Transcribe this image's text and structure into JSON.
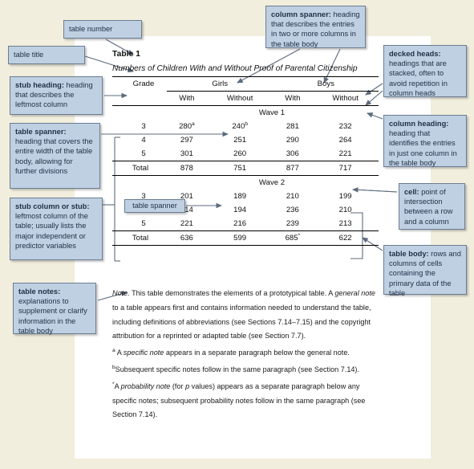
{
  "colors": {
    "page_background": "#f2eedd",
    "panel_background": "#ffffff",
    "callout_fill": "#bfd0e3",
    "callout_border": "#6a7d92",
    "callout_text": "#1f2f45",
    "rule_color": "#000000",
    "arrow_color": "#5c6b7d"
  },
  "table": {
    "number": "Table 1",
    "title": "Numbers of Children With and Without Proof of Parental Citizenship",
    "stub_heading": "Grade",
    "column_spanners": [
      "Girls",
      "Boys"
    ],
    "column_headings": [
      "With",
      "Without",
      "With",
      "Without"
    ],
    "table_spanners": [
      "Wave 1",
      "Wave 2"
    ],
    "total_label": "Total",
    "sections": [
      {
        "spanner": "Wave 1",
        "rows": [
          {
            "grade": "3",
            "girls_with": "280",
            "girls_with_note": "a",
            "girls_without": "240",
            "girls_without_note": "b",
            "boys_with": "281",
            "boys_without": "232"
          },
          {
            "grade": "4",
            "girls_with": "297",
            "girls_with_note": "",
            "girls_without": "251",
            "girls_without_note": "",
            "boys_with": "290",
            "boys_without": "264"
          },
          {
            "grade": "5",
            "girls_with": "301",
            "girls_with_note": "",
            "girls_without": "260",
            "girls_without_note": "",
            "boys_with": "306",
            "boys_without": "221"
          }
        ],
        "total": {
          "grade": "Total",
          "girls_with": "878",
          "girls_with_note": "",
          "girls_without": "751",
          "girls_without_note": "",
          "boys_with": "877",
          "boys_with_note": "",
          "boys_without": "717"
        }
      },
      {
        "spanner": "Wave 2",
        "rows": [
          {
            "grade": "3",
            "girls_with": "201",
            "girls_with_note": "",
            "girls_without": "189",
            "girls_without_note": "",
            "boys_with": "210",
            "boys_without": "199"
          },
          {
            "grade": "4",
            "girls_with": "214",
            "girls_with_note": "",
            "girls_without": "194",
            "girls_without_note": "",
            "boys_with": "236",
            "boys_without": "210"
          },
          {
            "grade": "5",
            "girls_with": "221",
            "girls_with_note": "",
            "girls_without": "216",
            "girls_without_note": "",
            "boys_with": "239",
            "boys_without": "213"
          }
        ],
        "total": {
          "grade": "Total",
          "girls_with": "636",
          "girls_with_note": "",
          "girls_without": "599",
          "girls_without_note": "",
          "boys_with": "685",
          "boys_with_note": "*",
          "boys_without": "622"
        }
      }
    ]
  },
  "notes": {
    "general_lead": "Note.",
    "general_part1": " This table demonstrates the elements of a prototypical table. A ",
    "general_italic1": "general note",
    "general_part2": " to a table appears first and contains information needed to understand the table, including definitions of abbreviations (see Sections 7.14–7.15) and the copyright attribution for a reprinted or adapted table (see Section 7.7).",
    "specific_a_marker": "a",
    "specific_a_part1": " A ",
    "specific_a_italic": "specific note",
    "specific_a_part2": " appears in a separate paragraph below the general note.",
    "specific_b_marker": "b",
    "specific_b_text": "Subsequent specific notes follow in the same paragraph (see Section 7.14).",
    "probability_marker": "*",
    "probability_part1": "A ",
    "probability_italic": "probability note",
    "probability_part2": " (for ",
    "probability_italic2": "p",
    "probability_part3": " values) appears as a separate paragraph below any specific notes; subsequent probability notes follow in the same paragraph (see Section 7.14)."
  },
  "callouts": {
    "table_number": {
      "label": "table number"
    },
    "table_title": {
      "label": "table title"
    },
    "stub_heading": {
      "bold": "stub heading:",
      "text": " heading that describes the leftmost column"
    },
    "table_spanner": {
      "bold": "table spanner:",
      "text": " heading that covers the entire width of the table body, allowing for further divisions"
    },
    "stub_column": {
      "bold": "stub column or stub:",
      "text": " leftmost column of the table; usually lists the major independent or predictor variables"
    },
    "table_notes": {
      "bold": "table notes:",
      "text": " explanations to supplement or clarify information in the table body"
    },
    "column_spanner": {
      "bold": "column spanner:",
      "text": " heading that describes the entries in two or more columns in the table body"
    },
    "decked_heads": {
      "bold": "decked heads:",
      "text": " headings that are stacked, often to avoid repetition in column heads"
    },
    "column_heading": {
      "bold": "column heading:",
      "text": " heading that identifies the entries in just one column in the table body"
    },
    "cell": {
      "bold": "cell:",
      "text": " point of intersection between a row and a column"
    },
    "table_body": {
      "bold": "table body:",
      "text": " rows and columns of cells containing the primary data of the table"
    },
    "table_spanner_inline": {
      "label": "table spanner"
    }
  }
}
